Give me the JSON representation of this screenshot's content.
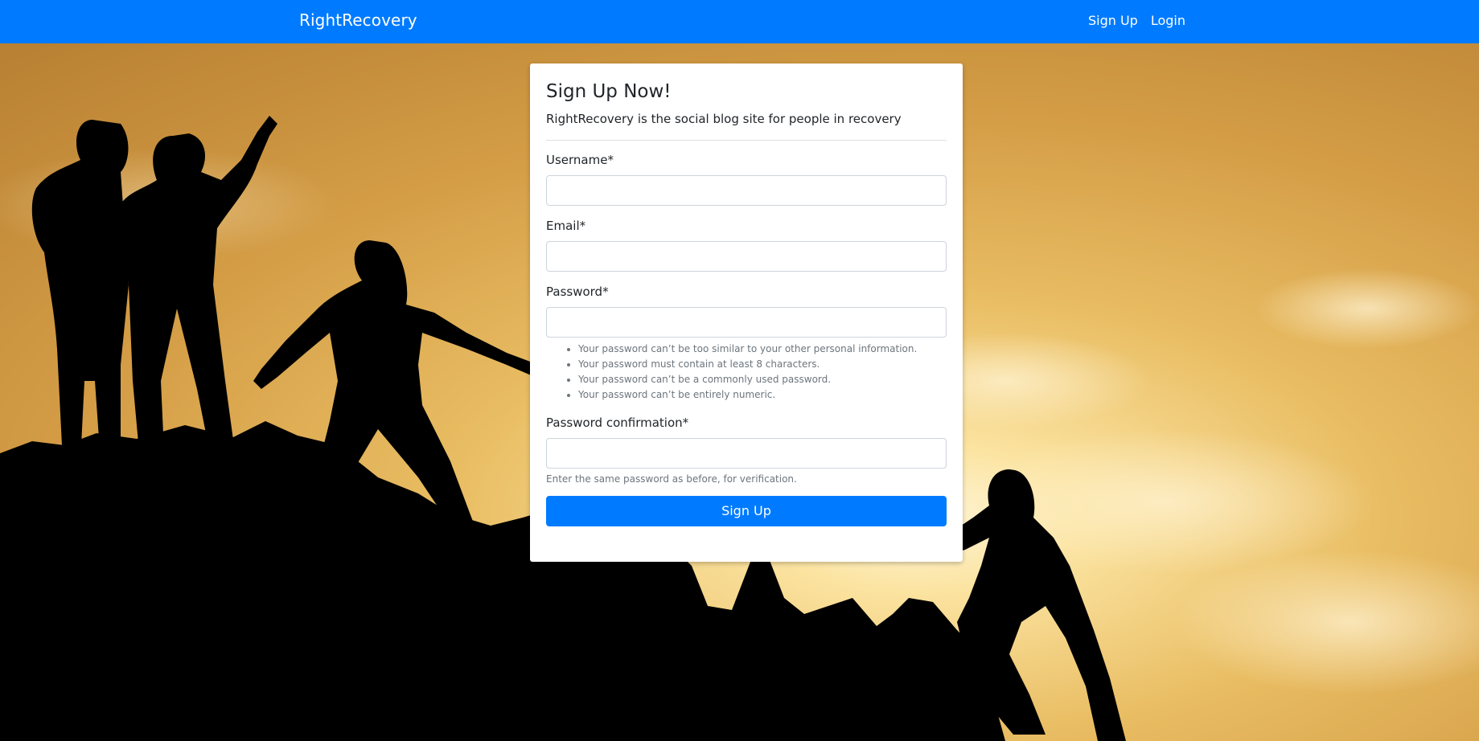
{
  "navbar": {
    "brand": "RightRecovery",
    "links": [
      "Sign Up",
      "Login"
    ],
    "background_color": "#007bff"
  },
  "form": {
    "title": "Sign Up Now!",
    "subtitle": "RightRecovery is the social blog site for people in recovery",
    "fields": {
      "username": {
        "label": "Username*",
        "value": ""
      },
      "email": {
        "label": "Email*",
        "value": ""
      },
      "password": {
        "label": "Password*",
        "value": "",
        "help": [
          "Your password can’t be too similar to your other personal information.",
          "Your password must contain at least 8 characters.",
          "Your password can’t be a commonly used password.",
          "Your password can’t be entirely numeric."
        ]
      },
      "password_confirmation": {
        "label": "Password confirmation*",
        "value": "",
        "help": "Enter the same password as before, for verification."
      }
    },
    "submit_label": "Sign Up",
    "button_color": "#007bff"
  },
  "background": {
    "image_subject": "silhouettes of people helping each other climb a rocky summit against a golden sunset sky"
  }
}
